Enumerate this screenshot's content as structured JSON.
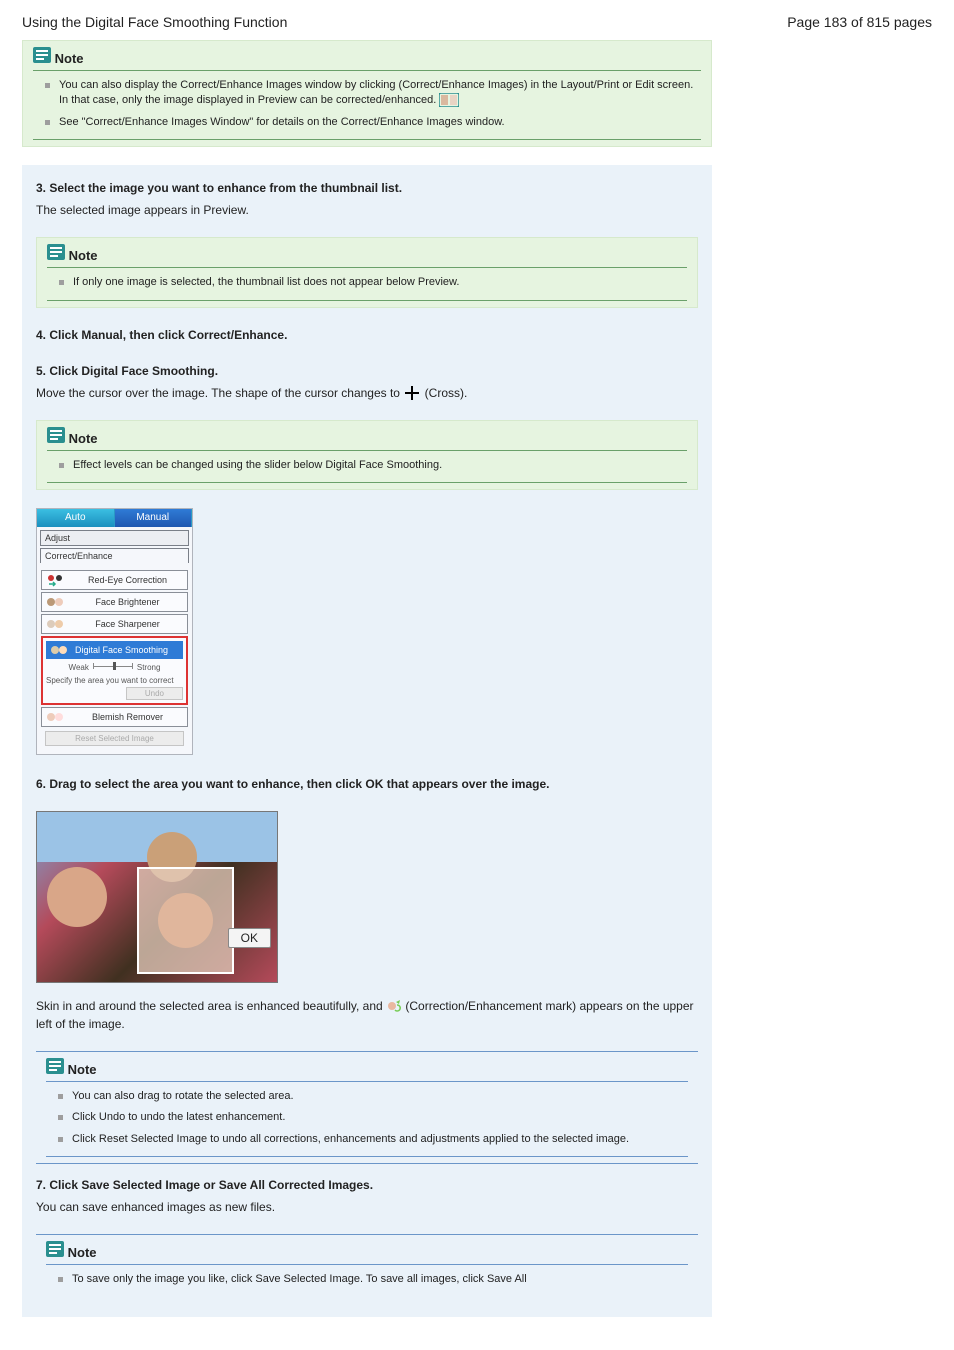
{
  "header": {
    "title": "Using the Digital Face Smoothing Function",
    "page_indicator": "Page 183 of 815 pages"
  },
  "green_note": {
    "heading": "Note",
    "items": [
      "You can also display the Correct/Enhance Images window by clicking (Correct/Enhance Images) in the Layout/Print or Edit screen. In that case, only the image displayed in Preview can be corrected/enhanced.",
      "See \"Correct/Enhance Images Window\" for details on the Correct/Enhance Images window."
    ],
    "items_suffix": [
      "",
      ""
    ],
    "compare_aria": "Correct/Enhance Images"
  },
  "step3": {
    "head": "3. Select the image you want to enhance from the thumbnail list.",
    "body": "The selected image appears in Preview."
  },
  "step3_note": "If only one image is selected, the thumbnail list does not appear below Preview.",
  "step4": {
    "head": "4. Click Manual, then click Correct/Enhance.",
    "body": ""
  },
  "step5": {
    "head": "5. Click Digital Face Smoothing.",
    "body_pre": "Move the cursor over the image. The shape of the cursor changes to ",
    "body_post": " (Cross)."
  },
  "step5_note": "Effect levels can be changed using the slider below Digital Face Smoothing.",
  "panel": {
    "tab_auto": "Auto",
    "tab_manual": "Manual",
    "sub_adjust": "Adjust",
    "sub_ce": "Correct/Enhance",
    "tools": {
      "redeye": "Red-Eye Correction",
      "brightener": "Face Brightener",
      "sharpener": "Face Sharpener",
      "dfs": "Digital Face Smoothing",
      "blemish": "Blemish Remover"
    },
    "slider": {
      "weak": "Weak",
      "strong": "Strong",
      "ticks": [
        "1",
        "2",
        "3"
      ]
    },
    "specify": "Specify the area you want to correct",
    "undo": "Undo",
    "reset": "Reset Selected Image"
  },
  "step6": {
    "head": "6. Drag to select the area you want to enhance, then click OK that appears over the image.",
    "ok": "OK",
    "result_pre": "Skin in and around the selected area is enhanced beautifully, and ",
    "result_post": " (Correction/Enhancement mark) appears on the upper left of the image."
  },
  "blue_note": {
    "heading": "Note",
    "items": [
      "You can also drag to rotate the selected area.",
      "Click Undo to undo the latest enhancement.",
      "Click Reset Selected Image to undo all corrections, enhancements and adjustments applied to the selected image."
    ]
  },
  "step7": {
    "head": "7. Click Save Selected Image or Save All Corrected Images.",
    "body": "You can save enhanced images as new files."
  },
  "last_note": {
    "heading": "Note",
    "items": [
      "To save only the image you like, click Save Selected Image. To save all images, click Save All"
    ]
  }
}
